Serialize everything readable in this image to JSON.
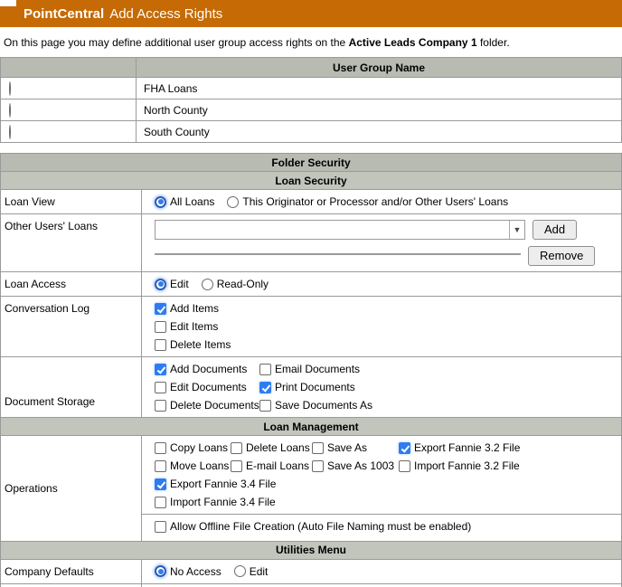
{
  "colors": {
    "header_orange": "#C56A04",
    "section_gray_main": "#B7BBB2",
    "section_gray_sub": "#C1C5BC",
    "accent_blue": "#2E7CF0",
    "border_gray": "#9A9A9A"
  },
  "header": {
    "brand": "PointCentral",
    "title": "Add Access Rights"
  },
  "intro": {
    "prefix": "On this page you may define additional user group access rights on the ",
    "folder": "Active Leads Company 1",
    "suffix": " folder."
  },
  "user_groups": {
    "column_header": "User Group Name",
    "rows": [
      {
        "name": "FHA Loans",
        "selected": false
      },
      {
        "name": "North County",
        "selected": false
      },
      {
        "name": "South County",
        "selected": false
      }
    ]
  },
  "folder_security": {
    "title": "Folder Security"
  },
  "loan_security": {
    "title": "Loan Security",
    "loan_view": {
      "label": "Loan View",
      "options": [
        {
          "label": "All Loans",
          "selected": true
        },
        {
          "label": "This Originator or Processor and/or Other Users' Loans",
          "selected": false
        }
      ]
    },
    "other_users_loans": {
      "label": "Other Users' Loans",
      "dropdown_value": "",
      "add_label": "Add",
      "remove_label": "Remove"
    },
    "loan_access": {
      "label": "Loan Access",
      "options": [
        {
          "label": "Edit",
          "selected": true
        },
        {
          "label": "Read-Only",
          "selected": false
        }
      ]
    },
    "conversation_log": {
      "label": "Conversation Log",
      "items": [
        {
          "label": "Add Items",
          "checked": true
        },
        {
          "label": "Edit Items",
          "checked": false
        },
        {
          "label": "Delete Items",
          "checked": false
        }
      ]
    },
    "document_storage": {
      "label": "Document Storage",
      "items": [
        {
          "label": "Add Documents",
          "checked": true
        },
        {
          "label": "Email Documents",
          "checked": false
        },
        {
          "label": "Edit Documents",
          "checked": false
        },
        {
          "label": "Print Documents",
          "checked": true
        },
        {
          "label": "Delete Documents",
          "checked": false
        },
        {
          "label": "Save Documents As",
          "checked": false
        }
      ]
    }
  },
  "loan_management": {
    "title": "Loan Management",
    "operations": {
      "label": "Operations",
      "grid": [
        {
          "label": "Copy Loans",
          "checked": false
        },
        {
          "label": "Delete Loans",
          "checked": false
        },
        {
          "label": "Save As",
          "checked": false
        },
        {
          "label": "Export Fannie 3.2 File",
          "checked": true
        },
        {
          "label": "Move Loans",
          "checked": false
        },
        {
          "label": "E-mail Loans",
          "checked": false
        },
        {
          "label": "Save As 1003",
          "checked": false
        },
        {
          "label": "Import Fannie 3.2 File",
          "checked": false
        }
      ],
      "extra": [
        {
          "label": "Export Fannie 3.4 File",
          "checked": true
        },
        {
          "label": "Import Fannie 3.4 File",
          "checked": false
        }
      ],
      "offline": {
        "label": "Allow Offline File Creation (Auto File Naming must be enabled)",
        "checked": false
      }
    }
  },
  "utilities_menu": {
    "title": "Utilities Menu",
    "company_defaults": {
      "label": "Company Defaults",
      "options": [
        {
          "label": "No Access",
          "selected": true
        },
        {
          "label": "Edit",
          "selected": false
        }
      ]
    }
  }
}
